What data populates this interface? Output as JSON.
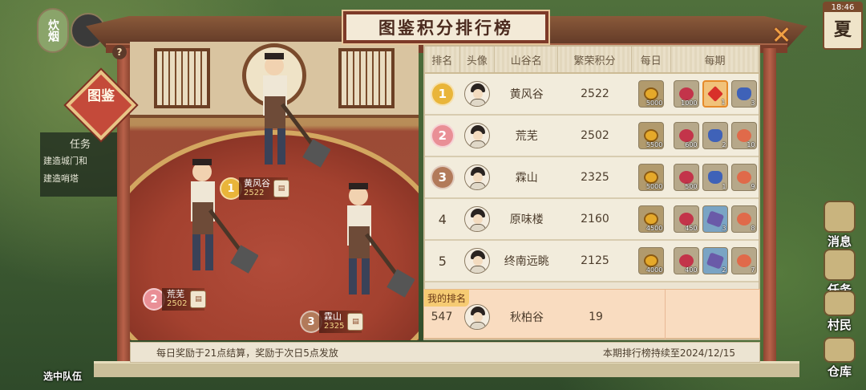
{
  "hud": {
    "left_button_text": "炊烟",
    "task_header": "任务",
    "task_item_1": "建造城门和",
    "task_item_2": "建造哨塔",
    "team_label": "选中队伍",
    "time": "18:46",
    "season": "夏",
    "right_buttons": [
      "消息",
      "任务",
      "村民",
      "仓库"
    ]
  },
  "modal": {
    "title": "图鉴积分排行榜",
    "badge": "图鉴",
    "help": "?",
    "close": "✕",
    "columns": [
      "排名",
      "头像",
      "山谷名",
      "繁荣积分",
      "每日",
      "每期"
    ],
    "rows": [
      {
        "rank": "1",
        "name": "黄风谷",
        "score": "2522",
        "daily": "5000",
        "period": [
          {
            "type": "fruit",
            "count": "1000"
          },
          {
            "type": "gem",
            "count": "1"
          },
          {
            "type": "bag",
            "count": "3"
          }
        ]
      },
      {
        "rank": "2",
        "name": "荒芜",
        "score": "2502",
        "daily": "5500",
        "period": [
          {
            "type": "fruit",
            "count": "600"
          },
          {
            "type": "bag",
            "count": "2"
          },
          {
            "type": "peach",
            "count": "10"
          }
        ]
      },
      {
        "rank": "3",
        "name": "霖山",
        "score": "2325",
        "daily": "5000",
        "period": [
          {
            "type": "fruit",
            "count": "500"
          },
          {
            "type": "bag",
            "count": "1"
          },
          {
            "type": "peach",
            "count": "9"
          }
        ]
      },
      {
        "rank": "4",
        "name": "原味楼",
        "score": "2160",
        "daily": "4500",
        "period": [
          {
            "type": "fruit",
            "count": "450"
          },
          {
            "type": "ore",
            "count": "3"
          },
          {
            "type": "peach",
            "count": "8"
          }
        ]
      },
      {
        "rank": "5",
        "name": "终南远眺",
        "score": "2125",
        "daily": "4000",
        "period": [
          {
            "type": "fruit",
            "count": "400"
          },
          {
            "type": "ore",
            "count": "2"
          },
          {
            "type": "peach",
            "count": "7"
          }
        ]
      }
    ],
    "my_rank": {
      "tag": "我的排名",
      "rank": "547",
      "name": "秋柏谷",
      "score": "19"
    },
    "podium": [
      {
        "rank": "1",
        "name": "黄风谷",
        "score": "2522"
      },
      {
        "rank": "2",
        "name": "荒芜",
        "score": "2502"
      },
      {
        "rank": "3",
        "name": "霖山",
        "score": "2325"
      }
    ],
    "footer_left": "每日奖励于21点结算，奖励于次日5点发放",
    "footer_right": "本期排行榜持续至2024/12/15"
  },
  "colors": {
    "gold": "#e9b53a",
    "pink": "#e98f96",
    "bronze": "#b27a5a",
    "frame": "#9a4a32"
  }
}
